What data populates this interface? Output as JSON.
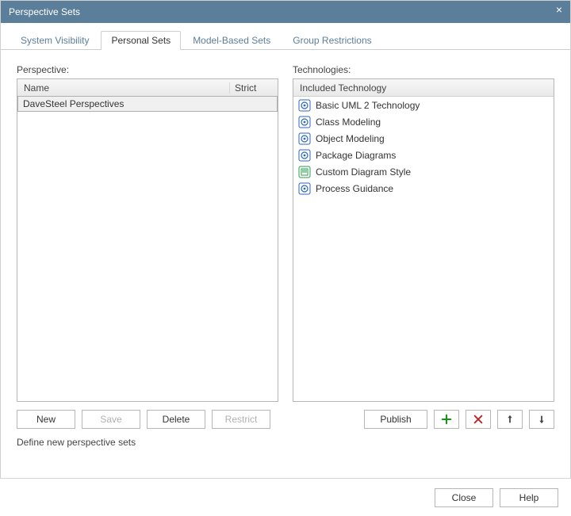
{
  "window": {
    "title": "Perspective Sets"
  },
  "tabs": {
    "items": [
      {
        "label": "System Visibility",
        "active": false
      },
      {
        "label": "Personal Sets",
        "active": true
      },
      {
        "label": "Model-Based Sets",
        "active": false
      },
      {
        "label": "Group Restrictions",
        "active": false
      }
    ]
  },
  "left": {
    "label": "Perspective:",
    "headers": {
      "name": "Name",
      "strict": "Strict"
    },
    "rows": [
      {
        "name": "DaveSteel Perspectives",
        "selected": true
      }
    ],
    "buttons": {
      "new": "New",
      "save": "Save",
      "delete": "Delete",
      "restrict": "Restrict"
    },
    "status": "Define new perspective sets"
  },
  "right": {
    "label": "Technologies:",
    "header": "Included Technology",
    "items": [
      {
        "label": "Basic UML 2 Technology",
        "icon": "gear"
      },
      {
        "label": "Class Modeling",
        "icon": "gear"
      },
      {
        "label": "Object Modeling",
        "icon": "gear"
      },
      {
        "label": "Package Diagrams",
        "icon": "gear"
      },
      {
        "label": "Custom Diagram Style",
        "icon": "doc"
      },
      {
        "label": "Process Guidance",
        "icon": "gear"
      }
    ],
    "buttons": {
      "publish": "Publish"
    }
  },
  "footer": {
    "close": "Close",
    "help": "Help"
  }
}
